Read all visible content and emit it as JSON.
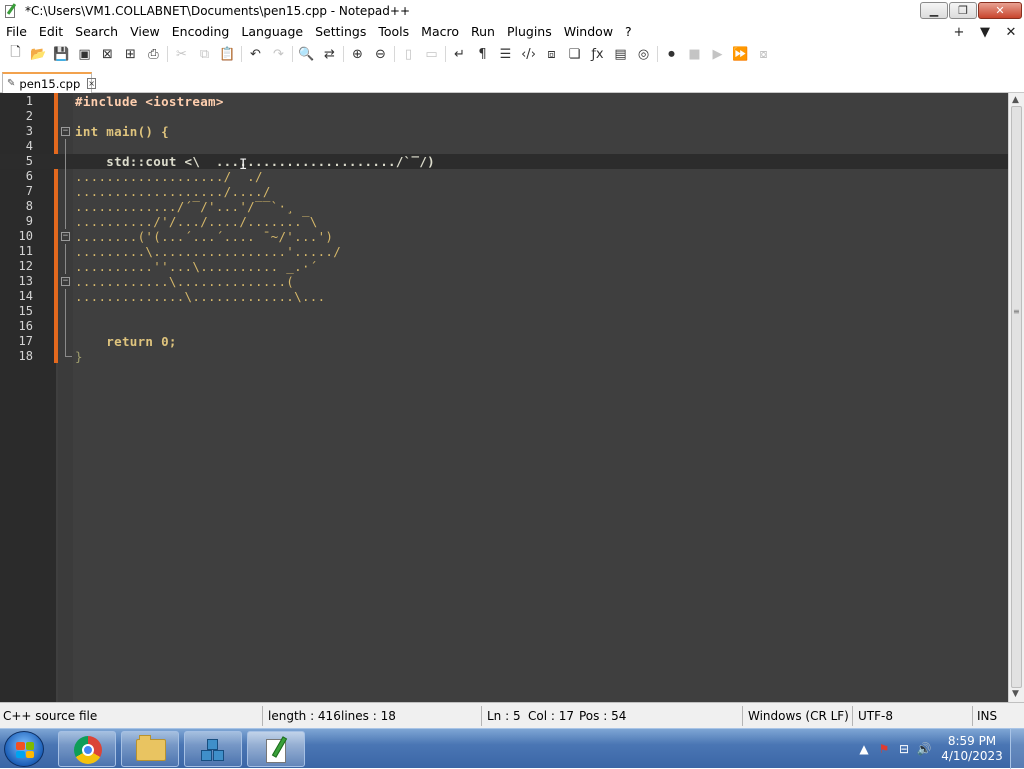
{
  "window": {
    "title": "*C:\\Users\\VM1.COLLABNET\\Documents\\pen15.cpp - Notepad++",
    "minimize_glyph": "▁",
    "maximize_glyph": "❐",
    "close_glyph": "✕"
  },
  "menubar": {
    "items": [
      "File",
      "Edit",
      "Search",
      "View",
      "Encoding",
      "Language",
      "Settings",
      "Tools",
      "Macro",
      "Run",
      "Plugins",
      "Window",
      "?"
    ],
    "right": [
      "+",
      "▼",
      "✕"
    ]
  },
  "toolbar": {
    "icons": [
      {
        "name": "new-file-icon",
        "glyph": "🗋",
        "enabled": true
      },
      {
        "name": "open-file-icon",
        "glyph": "📂",
        "enabled": true
      },
      {
        "name": "save-icon",
        "glyph": "💾",
        "enabled": true
      },
      {
        "name": "save-all-icon",
        "glyph": "▣",
        "enabled": true
      },
      {
        "name": "close-icon",
        "glyph": "⊠",
        "enabled": true
      },
      {
        "name": "close-all-icon",
        "glyph": "⊞",
        "enabled": true
      },
      {
        "name": "print-icon",
        "glyph": "⎙",
        "enabled": true
      },
      {
        "name": "sep"
      },
      {
        "name": "cut-icon",
        "glyph": "✂",
        "enabled": false
      },
      {
        "name": "copy-icon",
        "glyph": "⧉",
        "enabled": false
      },
      {
        "name": "paste-icon",
        "glyph": "📋",
        "enabled": true
      },
      {
        "name": "sep"
      },
      {
        "name": "undo-icon",
        "glyph": "↶",
        "enabled": true
      },
      {
        "name": "redo-icon",
        "glyph": "↷",
        "enabled": false
      },
      {
        "name": "sep"
      },
      {
        "name": "find-icon",
        "glyph": "🔍",
        "enabled": true
      },
      {
        "name": "replace-icon",
        "glyph": "⇄",
        "enabled": true
      },
      {
        "name": "sep"
      },
      {
        "name": "zoom-in-icon",
        "glyph": "⊕",
        "enabled": true
      },
      {
        "name": "zoom-out-icon",
        "glyph": "⊖",
        "enabled": true
      },
      {
        "name": "sep"
      },
      {
        "name": "sync-vertical-icon",
        "glyph": "▯",
        "enabled": false
      },
      {
        "name": "sync-horizontal-icon",
        "glyph": "▭",
        "enabled": false
      },
      {
        "name": "sep"
      },
      {
        "name": "word-wrap-icon",
        "glyph": "↵",
        "enabled": true
      },
      {
        "name": "show-all-chars-icon",
        "glyph": "¶",
        "enabled": true
      },
      {
        "name": "indent-guide-icon",
        "glyph": "☰",
        "enabled": true
      },
      {
        "name": "xml-tag-icon",
        "glyph": "‹/›",
        "enabled": true
      },
      {
        "name": "document-map-icon",
        "glyph": "⧈",
        "enabled": true
      },
      {
        "name": "document-list-icon",
        "glyph": "❏",
        "enabled": true
      },
      {
        "name": "function-list-icon",
        "glyph": "ƒx",
        "enabled": true
      },
      {
        "name": "folder-as-workspace-icon",
        "glyph": "▤",
        "enabled": true
      },
      {
        "name": "monitoring-icon",
        "glyph": "◎",
        "enabled": true
      },
      {
        "name": "sep"
      },
      {
        "name": "record-macro-icon",
        "glyph": "⏺",
        "enabled": true
      },
      {
        "name": "stop-recording-icon",
        "glyph": "■",
        "enabled": false
      },
      {
        "name": "play-macro-icon",
        "glyph": "▶",
        "enabled": false
      },
      {
        "name": "run-macro-multiple-icon",
        "glyph": "⏩",
        "enabled": true
      },
      {
        "name": "save-macro-icon",
        "glyph": "⧇",
        "enabled": false
      }
    ]
  },
  "tabs": [
    {
      "label": "pen15.cpp",
      "modified_glyph": "✎",
      "close_glyph": "×"
    }
  ],
  "editor": {
    "current_line": 5,
    "lines": [
      {
        "n": "1",
        "text": "#include <iostream>",
        "style": "preproc",
        "fold": ""
      },
      {
        "n": "2",
        "text": "",
        "style": "plain",
        "fold": ""
      },
      {
        "n": "3",
        "text": "int main() {",
        "style": "kw",
        "fold": "open"
      },
      {
        "n": "4",
        "text": "",
        "style": "plain",
        "fold": "line"
      },
      {
        "n": "5",
        "text": "    std::cout <\\  ......................./`‾/)",
        "style": "plain",
        "fold": "line"
      },
      {
        "n": "6",
        "text": ".................../  ./",
        "style": "dots",
        "fold": "line"
      },
      {
        "n": "7",
        "text": ".................../..../",
        "style": "dots",
        "fold": "line"
      },
      {
        "n": "8",
        "text": "............./´‾/'...'/‾‾`·¸",
        "style": "dots",
        "fold": "line"
      },
      {
        "n": "9",
        "text": "........../'/.../..../.......‾\\",
        "style": "dots",
        "fold": "line"
      },
      {
        "n": "10",
        "text": "........('(...´...´.... ¯~/'...')",
        "style": "dots",
        "fold": "open"
      },
      {
        "n": "11",
        "text": ".........\\.................'...../",
        "style": "dots",
        "fold": "line"
      },
      {
        "n": "12",
        "text": "..........''...\\.......... _.·´",
        "style": "dots",
        "fold": "line"
      },
      {
        "n": "13",
        "text": "............\\..............(",
        "style": "dots",
        "fold": "open"
      },
      {
        "n": "14",
        "text": "..............\\.............\\...",
        "style": "dots",
        "fold": "line"
      },
      {
        "n": "15",
        "text": "",
        "style": "plain",
        "fold": "line"
      },
      {
        "n": "16",
        "text": "",
        "style": "plain",
        "fold": "line"
      },
      {
        "n": "17",
        "text": "    return 0;",
        "style": "kw",
        "fold": "line"
      },
      {
        "n": "18",
        "text": "}",
        "style": "brace",
        "fold": "end"
      }
    ]
  },
  "scrollbar": {
    "up_glyph": "▲",
    "down_glyph": "▼",
    "grip_glyph": "≡"
  },
  "statusbar": {
    "file_type": "C++ source file",
    "length": "length : 416",
    "lines": "lines : 18",
    "ln": "Ln : 5",
    "col": "Col : 17",
    "pos": "Pos : 54",
    "eol": "Windows (CR LF)",
    "encoding": "UTF-8",
    "mode": "INS"
  },
  "taskbar": {
    "tray_glyphs": [
      "▲",
      "⚑",
      "⊟",
      "🔊"
    ],
    "time": "8:59 PM",
    "date": "4/10/2023"
  },
  "colors": {
    "editor_bg": "#3f3f3f",
    "change_bar": "#e4691e",
    "tab_accent": "#f2a24d",
    "taskbar": "#4a76b4"
  }
}
